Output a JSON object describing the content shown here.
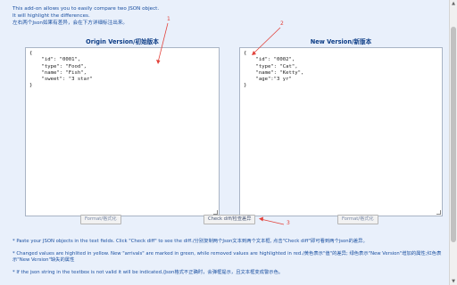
{
  "intro": {
    "line1": "This add-on allows you to easily compare two JSON object.",
    "line2": "It will highlight the differences.",
    "line3": "左右两个Json如果有差异，会在下方详细标注出来。"
  },
  "left_panel": {
    "title": "Origin Version/初始版本",
    "content": "{\n    \"id\": \"0001\",\n    \"type\": \"Food\",\n    \"name\": \"Fish\",\n    \"sweet\": \"3 star\"\n}",
    "format_label": "Format/格式化"
  },
  "right_panel": {
    "title": "New Version/新版本",
    "content": "{\n    \"id\": \"0002\",\n    \"type\": \"Cat\",\n    \"name\": \"Ketty\",\n    \"age\":\"3 yr\"\n}",
    "format_label": "Format/格式化"
  },
  "diff_button_label": "Check diff/检查差异",
  "notes": [
    "* Paste your JSON objects in the text fields. Click \"Check diff\" to see the diff./分别复制两个Json文本到两个文本框, 点击\"Check diff\"即可看到两个json的差异。",
    "* Changed values are highlited in yellow. New \"arrivals\" are marked in green, while removed values are highlighted in red./黄色表示\"值\"的差异; 绿色表示\"New Version\"增加的属性;红色表示\"New Version\"缺失的属性",
    "* If the json string in the textbox is not valid it will be indicated./Json格式不正确时，会弹框提示，且文本框变成警示色。"
  ],
  "annotations": {
    "marker1": "1",
    "marker2": "2",
    "marker3": "3"
  },
  "colors": {
    "background": "#e9f0fb",
    "text_blue": "#1a4fa0",
    "title_blue": "#0c3c86",
    "annotation_red": "#e2423b"
  }
}
